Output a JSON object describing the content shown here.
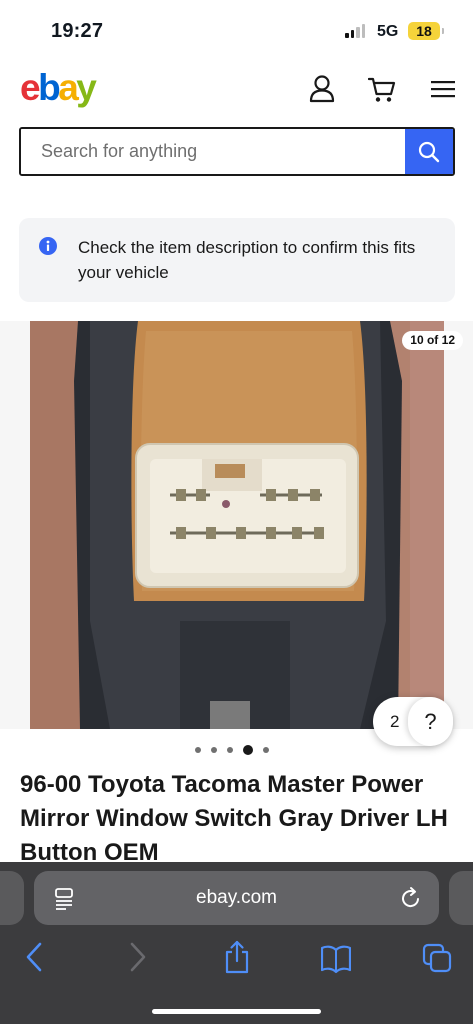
{
  "status": {
    "time": "19:27",
    "network": "5G",
    "battery": "18"
  },
  "header": {
    "logo_letters": [
      "e",
      "b",
      "a",
      "y"
    ]
  },
  "search": {
    "placeholder": "Search for anything"
  },
  "notice": {
    "text": "Check the item description to confirm this fits your vehicle"
  },
  "gallery": {
    "counter": "10 of 12",
    "help_count": "2",
    "help_symbol": "?",
    "current_index": 10,
    "total": 12
  },
  "listing": {
    "title": "96-00 Toyota Tacoma Master Power Mirror Window Switch Gray Driver LH Button OEM"
  },
  "browser": {
    "address": "ebay.com"
  },
  "colors": {
    "ebay_red": "#e53238",
    "ebay_blue": "#0064d2",
    "ebay_yellow": "#f5af02",
    "ebay_green": "#86b817",
    "search_button": "#3665f3",
    "browser_blue": "#4f8ef7"
  }
}
